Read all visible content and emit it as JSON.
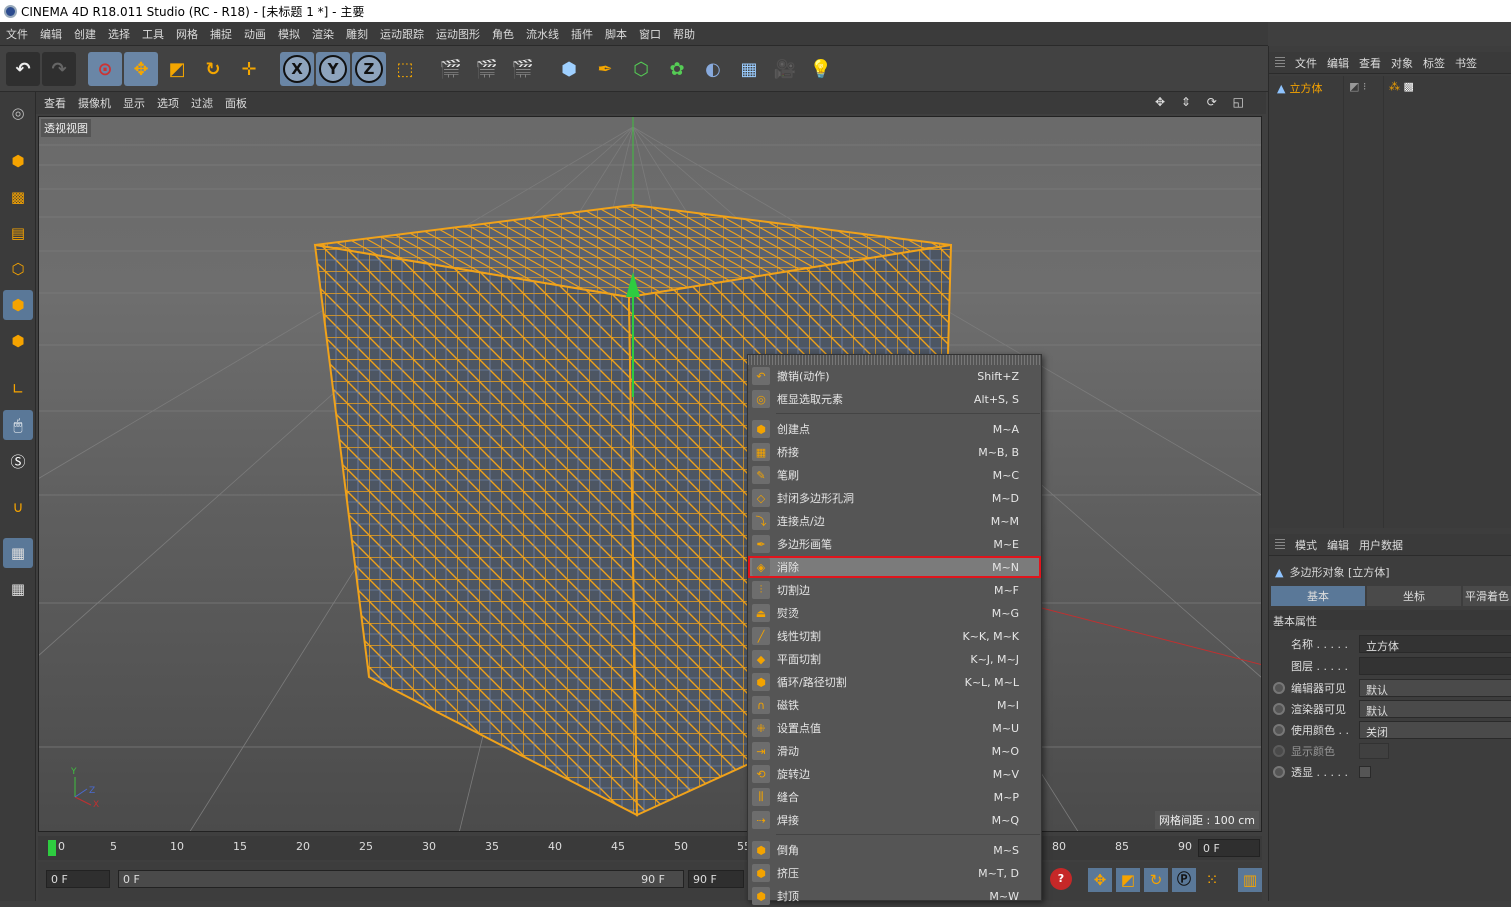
{
  "titlebar": {
    "title": "CINEMA 4D R18.011 Studio (RC - R18) - [未标题 1 *] - 主要"
  },
  "menubar": {
    "items": [
      "文件",
      "编辑",
      "创建",
      "选择",
      "工具",
      "网格",
      "捕捉",
      "动画",
      "模拟",
      "渲染",
      "雕刻",
      "运动跟踪",
      "运动图形",
      "角色",
      "流水线",
      "插件",
      "脚本",
      "窗口",
      "帮助"
    ]
  },
  "toolbar": {
    "x_label": "X",
    "y_label": "Y",
    "z_label": "Z"
  },
  "viewport": {
    "menu": [
      "查看",
      "摄像机",
      "显示",
      "选项",
      "过滤",
      "面板"
    ],
    "label": "透视视图",
    "grid_info": "网格间距 : 100 cm",
    "axis": {
      "y": "Y",
      "z": "Z",
      "x": "X"
    }
  },
  "context_menu": {
    "items": [
      {
        "label": "撤销(动作)",
        "shortcut": "Shift+Z",
        "icon": "undo-icon"
      },
      {
        "label": "框显选取元素",
        "shortcut": "Alt+S, S",
        "icon": "frame-selection-icon"
      },
      {
        "label": "创建点",
        "shortcut": "M~A",
        "icon": "create-point-icon"
      },
      {
        "label": "桥接",
        "shortcut": "M~B, B",
        "icon": "bridge-icon"
      },
      {
        "label": "笔刷",
        "shortcut": "M~C",
        "icon": "brush-icon"
      },
      {
        "label": "封闭多边形孔洞",
        "shortcut": "M~D",
        "icon": "close-hole-icon"
      },
      {
        "label": "连接点/边",
        "shortcut": "M~M",
        "icon": "connect-icon"
      },
      {
        "label": "多边形画笔",
        "shortcut": "M~E",
        "icon": "polygon-pen-icon"
      },
      {
        "label": "消除",
        "shortcut": "M~N",
        "icon": "dissolve-icon"
      },
      {
        "label": "切割边",
        "shortcut": "M~F",
        "icon": "edge-cut-icon"
      },
      {
        "label": "熨烫",
        "shortcut": "M~G",
        "icon": "iron-icon"
      },
      {
        "label": "线性切割",
        "shortcut": "K~K, M~K",
        "icon": "knife-icon"
      },
      {
        "label": "平面切割",
        "shortcut": "K~J, M~J",
        "icon": "plane-cut-icon"
      },
      {
        "label": "循环/路径切割",
        "shortcut": "K~L, M~L",
        "icon": "loop-cut-icon"
      },
      {
        "label": "磁铁",
        "shortcut": "M~I",
        "icon": "magnet-icon"
      },
      {
        "label": "设置点值",
        "shortcut": "M~U",
        "icon": "set-point-value-icon"
      },
      {
        "label": "滑动",
        "shortcut": "M~O",
        "icon": "slide-icon"
      },
      {
        "label": "旋转边",
        "shortcut": "M~V",
        "icon": "spin-edge-icon"
      },
      {
        "label": "缝合",
        "shortcut": "M~P",
        "icon": "stitch-icon"
      },
      {
        "label": "焊接",
        "shortcut": "M~Q",
        "icon": "weld-icon"
      },
      {
        "label": "倒角",
        "shortcut": "M~S",
        "icon": "bevel-icon"
      },
      {
        "label": "挤压",
        "shortcut": "M~T, D",
        "icon": "extrude-icon"
      },
      {
        "label": "封顶",
        "shortcut": "M~W",
        "icon": "cap-icon"
      }
    ]
  },
  "timeline": {
    "ticks": [
      "0",
      "5",
      "10",
      "15",
      "20",
      "25",
      "30",
      "35",
      "40",
      "45",
      "50",
      "55",
      "80",
      "85",
      "90"
    ],
    "current_frame": "0 F",
    "start_field": "0 F",
    "slider_start": "0 F",
    "slider_end": "90 F",
    "end_field": "90 F",
    "end_frame": "0 F"
  },
  "object_manager": {
    "menu": [
      "文件",
      "编辑",
      "查看",
      "对象",
      "标签",
      "书签"
    ],
    "object_name": "立方体"
  },
  "attribute_manager": {
    "menu": [
      "模式",
      "编辑",
      "用户数据"
    ],
    "object_title": "多边形对象 [立方体]",
    "tabs": [
      "基本",
      "坐标",
      "平滑着色"
    ],
    "section": "基本属性",
    "rows": [
      {
        "label": "名称 . . . . .",
        "value": "立方体"
      },
      {
        "label": "图层 . . . . .",
        "value": ""
      },
      {
        "label": "编辑器可见",
        "value": "默认"
      },
      {
        "label": "渲染器可见",
        "value": "默认"
      },
      {
        "label": "使用颜色 . .",
        "value": "关闭"
      },
      {
        "label": "显示颜色",
        "value": ""
      },
      {
        "label": "透显 . . . . .",
        "value": ""
      }
    ]
  },
  "colors": {
    "accent": "#f5a300",
    "highlight_border": "#e0141c",
    "selection_blue": "#5a7898"
  }
}
